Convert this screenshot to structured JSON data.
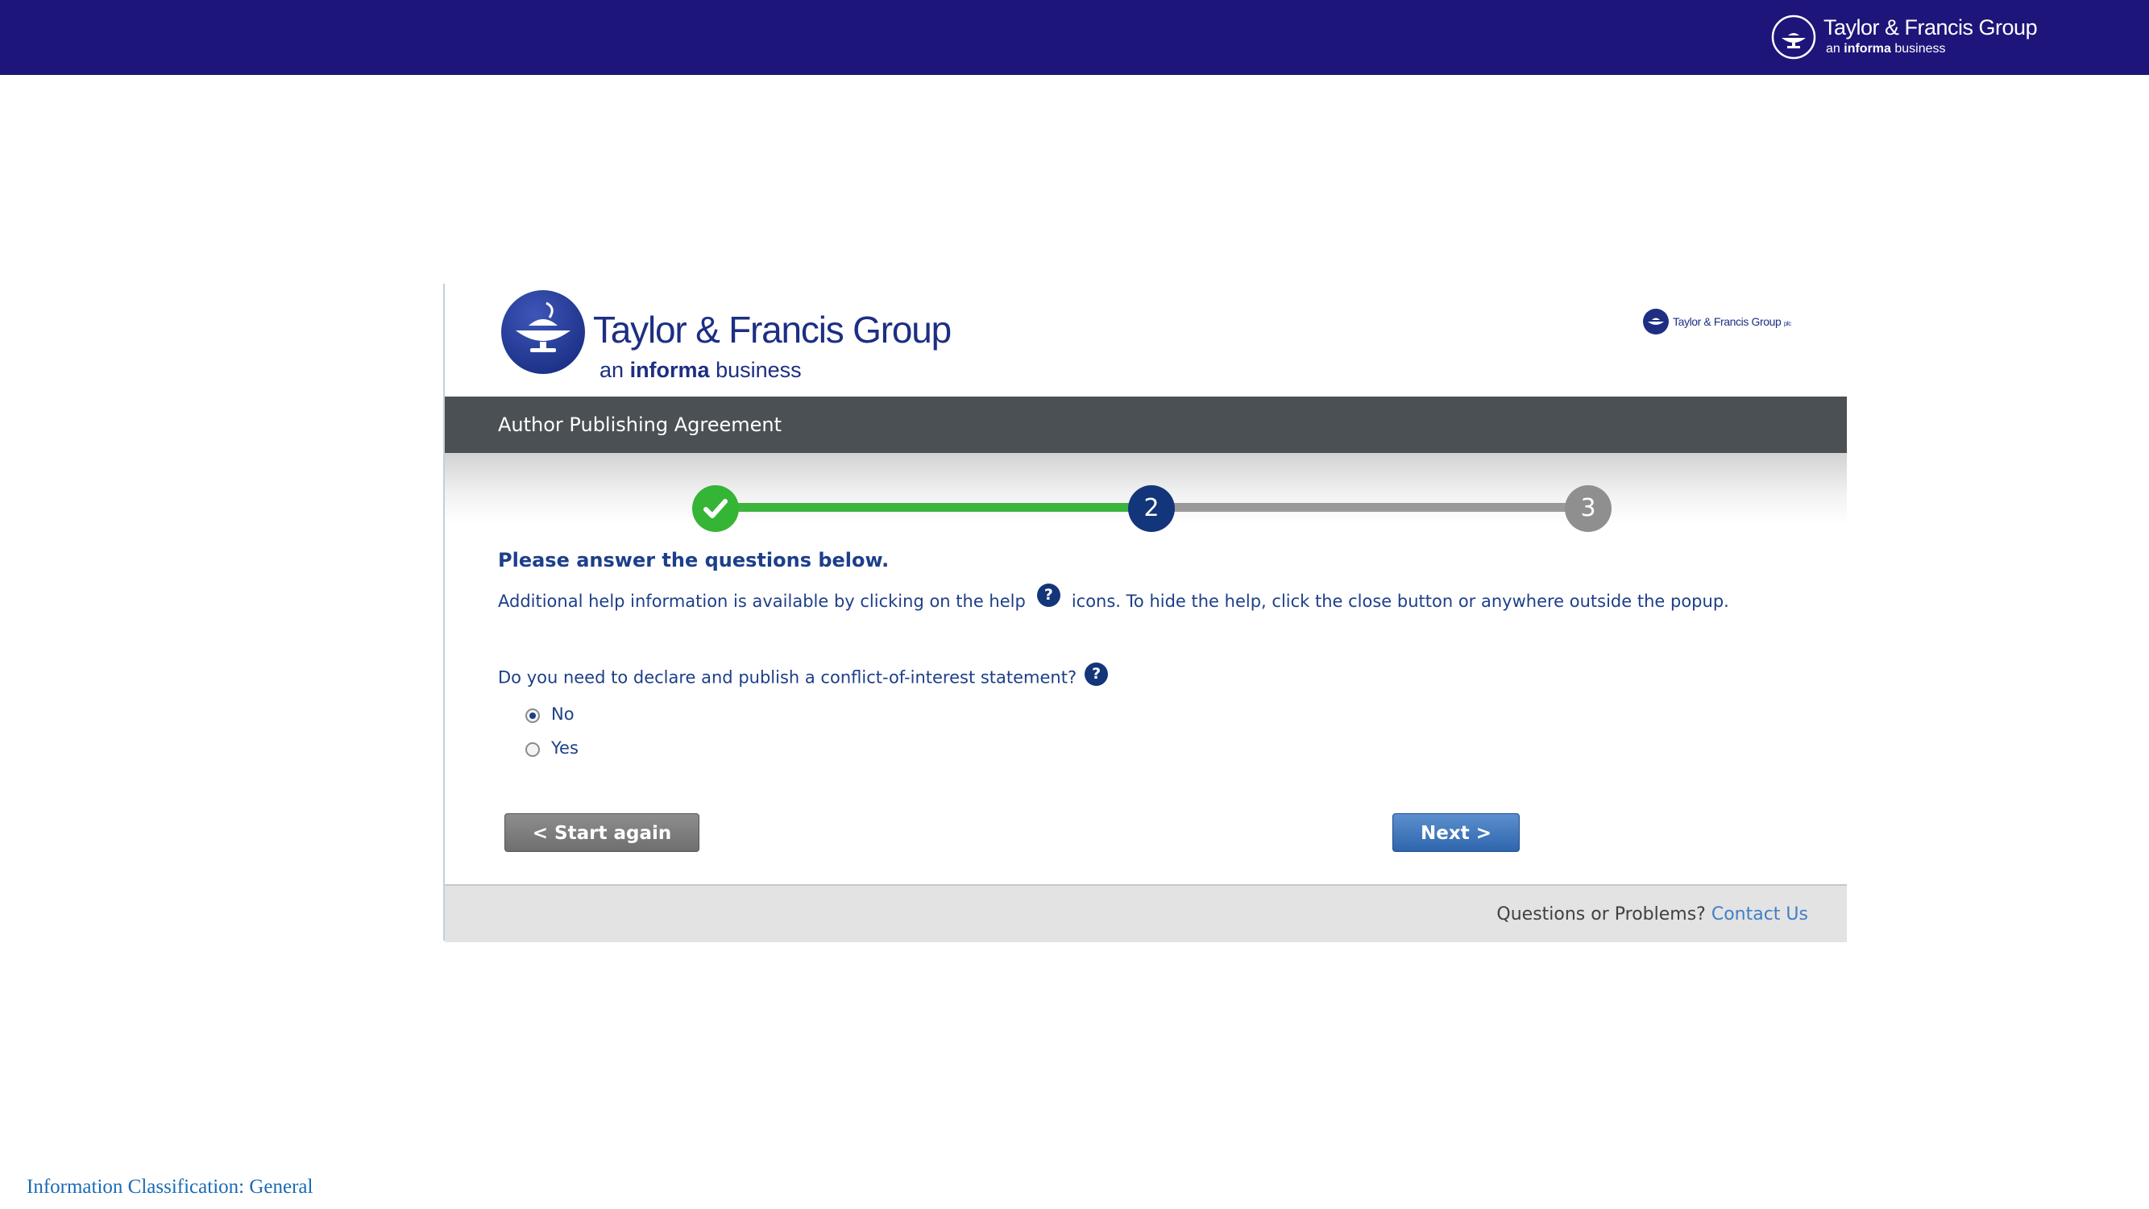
{
  "banner": {
    "logo_name": "Taylor & Francis Group",
    "logo_sub_prefix": "an",
    "logo_sub_bold": "informa",
    "logo_sub_suffix": "business",
    "color": "#1e157a"
  },
  "card": {
    "main_logo": {
      "name": "Taylor & Francis Group",
      "sub_prefix": "an",
      "sub_bold": "informa",
      "sub_suffix": "business"
    },
    "small_logo": {
      "name": "Taylor & Francis Group",
      "suffix": "plc"
    },
    "title": "Author Publishing Agreement",
    "stepper": {
      "steps": [
        {
          "label": "",
          "state": "completed",
          "icon": "check-icon"
        },
        {
          "label": "2",
          "state": "current"
        },
        {
          "label": "3",
          "state": "upcoming"
        }
      ],
      "colors": {
        "completed": "#35b535",
        "current": "#13357a",
        "upcoming": "#8f8f8f"
      }
    },
    "instruction": "Please answer the questions below.",
    "help_text_before": "Additional help information is available by clicking on the help",
    "help_text_after": "icons. To hide the help, click the close button or anywhere outside the popup.",
    "help_icon_glyph": "?",
    "question": "Do you need to declare and publish a conflict-of-interest statement?",
    "options": [
      {
        "label": "No",
        "selected": true
      },
      {
        "label": "Yes",
        "selected": false
      }
    ],
    "buttons": {
      "start_again": "< Start again",
      "next": "Next >"
    },
    "footer": {
      "question": "Questions or Problems?",
      "link": "Contact Us"
    }
  },
  "classification": "Information Classification: General"
}
